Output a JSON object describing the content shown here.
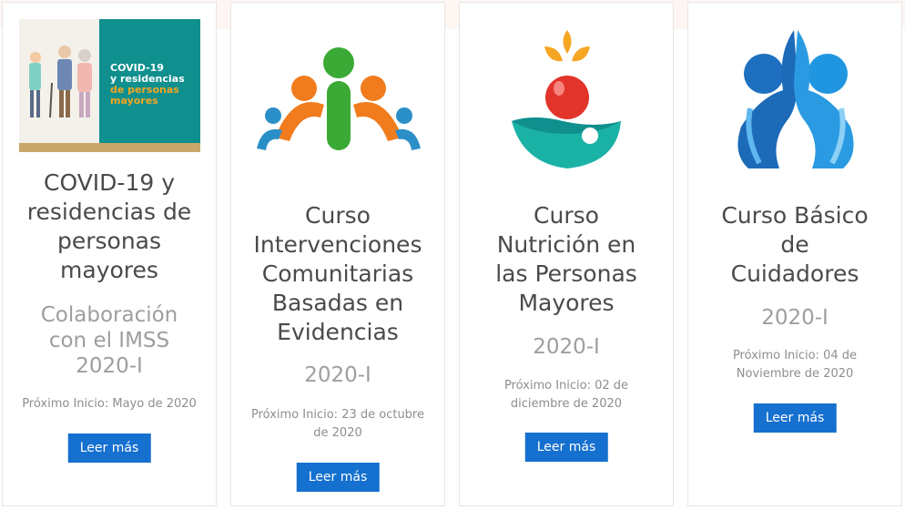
{
  "courses": [
    {
      "title_lines": [
        "COVID-19 y",
        "residencias de",
        "personas",
        "mayores"
      ],
      "subtitle_lines": [
        "Colaboración",
        "con el IMSS",
        "2020-I"
      ],
      "start_lines": [
        "Próximo Inicio: Mayo de 2020"
      ],
      "button": "Leer más",
      "image_text": {
        "line1": "COVID-19",
        "line2": "y residencias",
        "line3": "de personas",
        "line4": "mayores"
      }
    },
    {
      "title_lines": [
        "Curso",
        "Intervenciones",
        "Comunitarias",
        "Basadas en",
        "Evidencias"
      ],
      "subtitle_lines": [
        "2020-I"
      ],
      "start_lines": [
        "Próximo Inicio: 23 de octubre",
        "de 2020"
      ],
      "button": "Leer más"
    },
    {
      "title_lines": [
        "Curso",
        "Nutrición en",
        "las Personas",
        "Mayores"
      ],
      "subtitle_lines": [
        "2020-I"
      ],
      "start_lines": [
        "Próximo Inicio: 02 de",
        "diciembre de 2020"
      ],
      "button": "Leer más"
    },
    {
      "title_lines": [
        "Curso Básico",
        "de",
        "Cuidadores"
      ],
      "subtitle_lines": [
        "2020-I"
      ],
      "start_lines": [
        "Próximo Inicio: 04 de",
        "Noviembre de 2020"
      ],
      "button": "Leer más"
    }
  ],
  "colors": {
    "button": "#1570cf",
    "title": "#4a4a4a",
    "subtitle": "#9e9e9e",
    "teal": "#0f8f8d",
    "accent": "#f5a623"
  }
}
